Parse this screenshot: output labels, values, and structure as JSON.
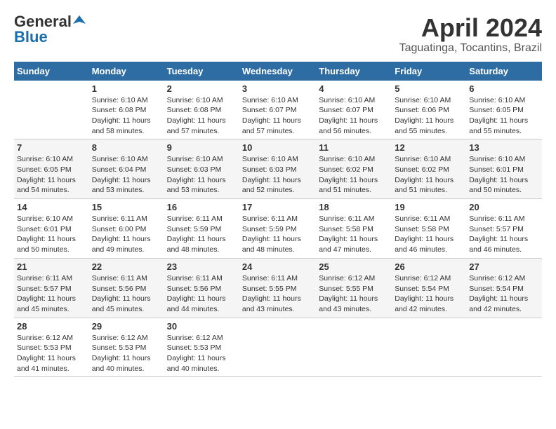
{
  "logo": {
    "general": "General",
    "blue": "Blue"
  },
  "title": "April 2024",
  "location": "Taguatinga, Tocantins, Brazil",
  "days_header": [
    "Sunday",
    "Monday",
    "Tuesday",
    "Wednesday",
    "Thursday",
    "Friday",
    "Saturday"
  ],
  "weeks": [
    [
      {
        "day": "",
        "info": ""
      },
      {
        "day": "1",
        "info": "Sunrise: 6:10 AM\nSunset: 6:08 PM\nDaylight: 11 hours\nand 58 minutes."
      },
      {
        "day": "2",
        "info": "Sunrise: 6:10 AM\nSunset: 6:08 PM\nDaylight: 11 hours\nand 57 minutes."
      },
      {
        "day": "3",
        "info": "Sunrise: 6:10 AM\nSunset: 6:07 PM\nDaylight: 11 hours\nand 57 minutes."
      },
      {
        "day": "4",
        "info": "Sunrise: 6:10 AM\nSunset: 6:07 PM\nDaylight: 11 hours\nand 56 minutes."
      },
      {
        "day": "5",
        "info": "Sunrise: 6:10 AM\nSunset: 6:06 PM\nDaylight: 11 hours\nand 55 minutes."
      },
      {
        "day": "6",
        "info": "Sunrise: 6:10 AM\nSunset: 6:05 PM\nDaylight: 11 hours\nand 55 minutes."
      }
    ],
    [
      {
        "day": "7",
        "info": "Sunrise: 6:10 AM\nSunset: 6:05 PM\nDaylight: 11 hours\nand 54 minutes."
      },
      {
        "day": "8",
        "info": "Sunrise: 6:10 AM\nSunset: 6:04 PM\nDaylight: 11 hours\nand 53 minutes."
      },
      {
        "day": "9",
        "info": "Sunrise: 6:10 AM\nSunset: 6:03 PM\nDaylight: 11 hours\nand 53 minutes."
      },
      {
        "day": "10",
        "info": "Sunrise: 6:10 AM\nSunset: 6:03 PM\nDaylight: 11 hours\nand 52 minutes."
      },
      {
        "day": "11",
        "info": "Sunrise: 6:10 AM\nSunset: 6:02 PM\nDaylight: 11 hours\nand 51 minutes."
      },
      {
        "day": "12",
        "info": "Sunrise: 6:10 AM\nSunset: 6:02 PM\nDaylight: 11 hours\nand 51 minutes."
      },
      {
        "day": "13",
        "info": "Sunrise: 6:10 AM\nSunset: 6:01 PM\nDaylight: 11 hours\nand 50 minutes."
      }
    ],
    [
      {
        "day": "14",
        "info": "Sunrise: 6:10 AM\nSunset: 6:01 PM\nDaylight: 11 hours\nand 50 minutes."
      },
      {
        "day": "15",
        "info": "Sunrise: 6:11 AM\nSunset: 6:00 PM\nDaylight: 11 hours\nand 49 minutes."
      },
      {
        "day": "16",
        "info": "Sunrise: 6:11 AM\nSunset: 5:59 PM\nDaylight: 11 hours\nand 48 minutes."
      },
      {
        "day": "17",
        "info": "Sunrise: 6:11 AM\nSunset: 5:59 PM\nDaylight: 11 hours\nand 48 minutes."
      },
      {
        "day": "18",
        "info": "Sunrise: 6:11 AM\nSunset: 5:58 PM\nDaylight: 11 hours\nand 47 minutes."
      },
      {
        "day": "19",
        "info": "Sunrise: 6:11 AM\nSunset: 5:58 PM\nDaylight: 11 hours\nand 46 minutes."
      },
      {
        "day": "20",
        "info": "Sunrise: 6:11 AM\nSunset: 5:57 PM\nDaylight: 11 hours\nand 46 minutes."
      }
    ],
    [
      {
        "day": "21",
        "info": "Sunrise: 6:11 AM\nSunset: 5:57 PM\nDaylight: 11 hours\nand 45 minutes."
      },
      {
        "day": "22",
        "info": "Sunrise: 6:11 AM\nSunset: 5:56 PM\nDaylight: 11 hours\nand 45 minutes."
      },
      {
        "day": "23",
        "info": "Sunrise: 6:11 AM\nSunset: 5:56 PM\nDaylight: 11 hours\nand 44 minutes."
      },
      {
        "day": "24",
        "info": "Sunrise: 6:11 AM\nSunset: 5:55 PM\nDaylight: 11 hours\nand 43 minutes."
      },
      {
        "day": "25",
        "info": "Sunrise: 6:12 AM\nSunset: 5:55 PM\nDaylight: 11 hours\nand 43 minutes."
      },
      {
        "day": "26",
        "info": "Sunrise: 6:12 AM\nSunset: 5:54 PM\nDaylight: 11 hours\nand 42 minutes."
      },
      {
        "day": "27",
        "info": "Sunrise: 6:12 AM\nSunset: 5:54 PM\nDaylight: 11 hours\nand 42 minutes."
      }
    ],
    [
      {
        "day": "28",
        "info": "Sunrise: 6:12 AM\nSunset: 5:53 PM\nDaylight: 11 hours\nand 41 minutes."
      },
      {
        "day": "29",
        "info": "Sunrise: 6:12 AM\nSunset: 5:53 PM\nDaylight: 11 hours\nand 40 minutes."
      },
      {
        "day": "30",
        "info": "Sunrise: 6:12 AM\nSunset: 5:53 PM\nDaylight: 11 hours\nand 40 minutes."
      },
      {
        "day": "",
        "info": ""
      },
      {
        "day": "",
        "info": ""
      },
      {
        "day": "",
        "info": ""
      },
      {
        "day": "",
        "info": ""
      }
    ]
  ]
}
